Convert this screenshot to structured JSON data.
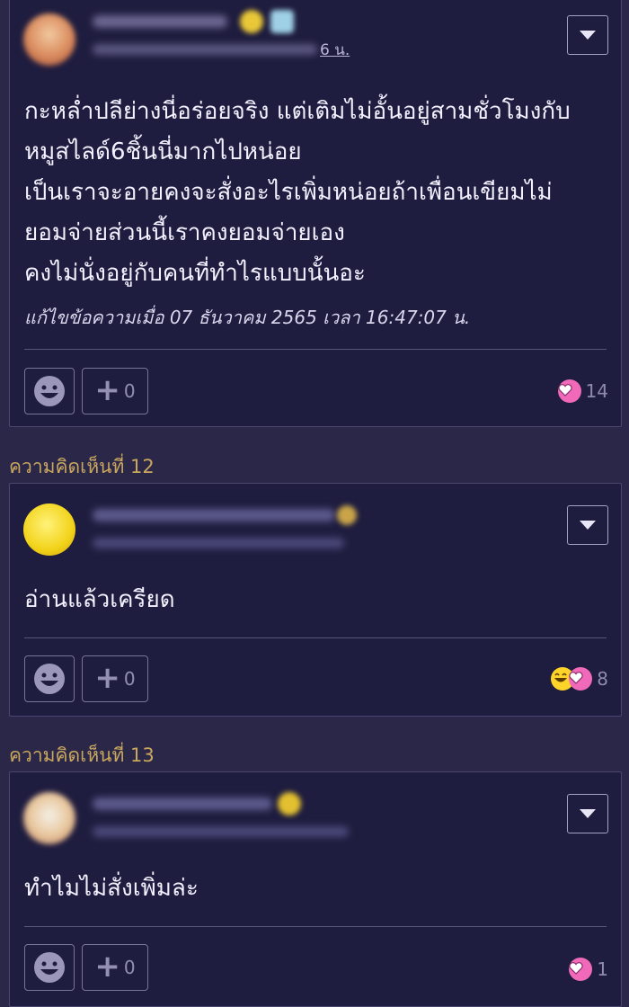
{
  "comments": [
    {
      "author_visible_fragment": "6 น.",
      "body_lines": [
        "กะหล่ำปลีย่างนี่อร่อยจริง แต่เติมไม่อั้นอยู่สามชั่วโมงกับ",
        "หมูสไลด์6ชิ้นนี่มากไปหน่อย",
        "เป็นเราจะอายคงจะสั่งอะไรเพิ่มหน่อยถ้าเพื่อนเขียมไม่",
        "ยอมจ่ายส่วนนี้เราคงยอมจ่ายเอง",
        "คงไม่นั่งอยู่กับคนที่ทำไรแบบนั้นอะ"
      ],
      "edited_note": "แก้ไขข้อความเมื่อ 07 ธันวาคม 2565 เวลา 16:47:07 น.",
      "plus_count": "0",
      "reaction_count": "14",
      "reaction_icons": [
        "heart-icon"
      ]
    },
    {
      "label": "ความคิดเห็นที่ 12",
      "body_lines": [
        "อ่านแล้วเครียด"
      ],
      "plus_count": "0",
      "reaction_count": "8",
      "reaction_icons": [
        "laugh-icon",
        "heart-icon"
      ]
    },
    {
      "label": "ความคิดเห็นที่ 13",
      "body_lines": [
        "ทำไมไม่สั่งเพิ่มล่ะ"
      ],
      "plus_count": "0",
      "reaction_count": "1",
      "reaction_icons": [
        "heart-icon"
      ]
    }
  ],
  "colors": {
    "background": "#2b2748",
    "card": "#1f1d3f",
    "label": "#c9a75e",
    "heart": "#f06ab9"
  }
}
